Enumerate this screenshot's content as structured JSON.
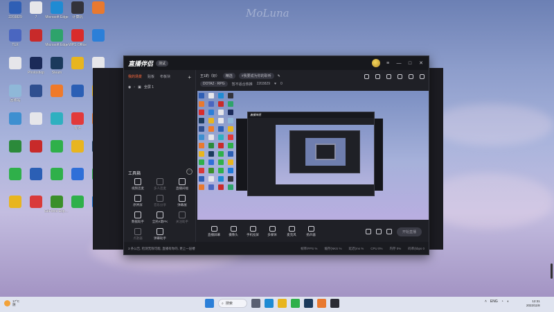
{
  "desktop": {
    "watermark": "MoLuna",
    "icons": [
      {
        "label": "2203829",
        "color": "#2f5fb5"
      },
      {
        "label": "7",
        "color": "#e6e6ea"
      },
      {
        "label": "Microsoft Edge",
        "color": "#1f8bd3"
      },
      {
        "label": "计算机",
        "color": "#33333b"
      },
      {
        "label": "",
        "color": "#e8792f"
      },
      {
        "label": "TLX",
        "color": "#4a66c0"
      },
      {
        "label": "",
        "color": "#c82a2a"
      },
      {
        "label": "Microsoft Edge",
        "color": "#2ea36b"
      },
      {
        "label": "WPS Office",
        "color": "#d92b2b"
      },
      {
        "label": "",
        "color": "#2b7fd8"
      },
      {
        "label": "",
        "color": "#e6e6ea"
      },
      {
        "label": "Photoshop",
        "color": "#1b2a58"
      },
      {
        "label": "Steam",
        "color": "#1b3a5c"
      },
      {
        "label": "",
        "color": "#e8b51f"
      },
      {
        "label": "",
        "color": "#e6e6ea"
      },
      {
        "label": "回收站",
        "color": "#8fb8d8"
      },
      {
        "label": "",
        "color": "#2f4f8f"
      },
      {
        "label": "",
        "color": "#f07a2a"
      },
      {
        "label": "",
        "color": "#2b5fb5"
      },
      {
        "label": "",
        "color": "#e8b51f"
      },
      {
        "label": "",
        "color": "#3e8fd0"
      },
      {
        "label": "",
        "color": "#e6e6ea"
      },
      {
        "label": "",
        "color": "#2fb0c0"
      },
      {
        "label": "有道",
        "color": "#e23a3a"
      },
      {
        "label": "",
        "color": "#e8792f"
      },
      {
        "label": "",
        "color": "#2b8a3a"
      },
      {
        "label": "",
        "color": "#c82a2a"
      },
      {
        "label": "",
        "color": "#2fb04a"
      },
      {
        "label": "",
        "color": "#e8b51f"
      },
      {
        "label": "",
        "color": "#1b3a5c"
      },
      {
        "label": "",
        "color": "#2fb04a"
      },
      {
        "label": "",
        "color": "#2b5fb5"
      },
      {
        "label": "",
        "color": "#2fb04a"
      },
      {
        "label": "",
        "color": "#2f6fd8"
      },
      {
        "label": "",
        "color": "#2fb04a"
      },
      {
        "label": "",
        "color": "#e8b51f"
      },
      {
        "label": "",
        "color": "#d93a3a"
      },
      {
        "label": "GeForce Experience",
        "color": "#3a8f2a"
      },
      {
        "label": "",
        "color": "#2fb04a"
      },
      {
        "label": "",
        "color": "#1e78d8"
      }
    ]
  },
  "app": {
    "title": "直播伴侣",
    "version": "测试",
    "side_tabs": [
      "我的场景",
      "贴板",
      "布板块"
    ],
    "scene_name": "全屏 1",
    "room": {
      "title": "王1的（好）",
      "badge": "精选",
      "tag": "#我要成为你的聆听",
      "category": "DOTA2 · RPG",
      "status": "暂不适合热推",
      "id": "2203829",
      "viewers": "0"
    },
    "toolbox": {
      "title": "工具箱",
      "more": "···",
      "tools": [
        {
          "label": "视频连麦",
          "dim": false
        },
        {
          "label": "多人连麦",
          "dim": true
        },
        {
          "label": "直播间福",
          "dim": false
        },
        {
          "label": "原神屏",
          "dim": false
        },
        {
          "label": "音乐分享",
          "dim": true
        },
        {
          "label": "弹幕展",
          "dim": false
        },
        {
          "label": "数据助手",
          "dim": false
        },
        {
          "label": "全民K歌PK",
          "dim": false
        },
        {
          "label": "关注助手",
          "dim": true
        },
        {
          "label": "点歌器",
          "dim": true
        },
        {
          "label": "弹幕助手",
          "dim": false
        }
      ]
    },
    "controls": [
      {
        "label": "直播屏幕",
        "name": "screen-capture-button"
      },
      {
        "label": "摄像头",
        "name": "camera-button"
      },
      {
        "label": "手机投屏",
        "name": "phone-cast-button"
      },
      {
        "label": "多媒体",
        "name": "media-button"
      },
      {
        "label": "麦克风",
        "name": "microphone-button"
      },
      {
        "label": "扬声器",
        "name": "speaker-button"
      }
    ],
    "start_button": "开始直播",
    "status_notice": "3 条公告, 检测无限可能, 直播有你的, 更上一层楼",
    "stats": [
      "帧率/FPS %",
      "缓存(NKS %",
      "延迟(ms %",
      "CPU 0%",
      "内存 0%",
      "码率(kbps 0"
    ]
  },
  "taskbar": {
    "weather_temp": "17°C",
    "weather_desc": "阴",
    "search_label": "搜索",
    "tray_lang": "ENG",
    "time": "12:31",
    "date": "2022/11/8",
    "apps": [
      {
        "name": "start-icon",
        "color": "#2b7fd8"
      },
      {
        "name": "task-view-icon",
        "color": "#5a6072"
      },
      {
        "name": "edge-icon",
        "color": "#1f8bd3"
      },
      {
        "name": "file-explorer-icon",
        "color": "#e8b51f"
      },
      {
        "name": "wechat-icon",
        "color": "#2fb04a"
      },
      {
        "name": "steam-icon",
        "color": "#1b3a5c"
      },
      {
        "name": "app-icon",
        "color": "#e8792f"
      },
      {
        "name": "stream-app-icon",
        "color": "#2b2c34"
      }
    ]
  }
}
